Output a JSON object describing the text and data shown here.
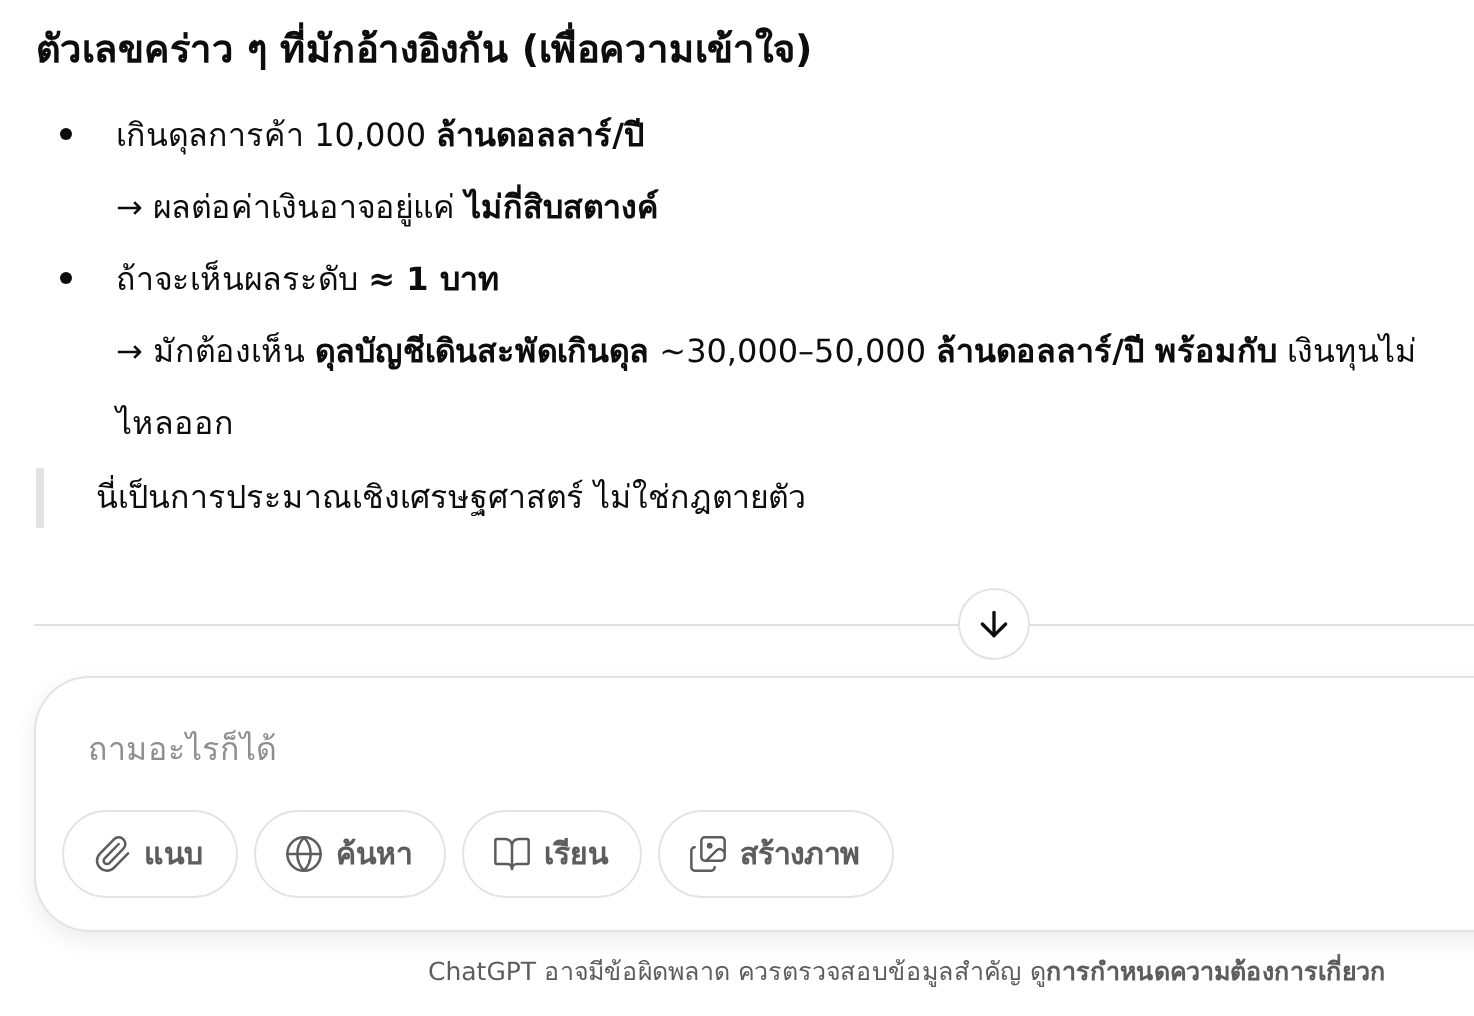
{
  "heading": "ตัวเลขคร่าว ๆ ที่มักอ้างอิงกัน (เพื่อความเข้าใจ)",
  "bullets": [
    {
      "lines": [
        "เกินดุลการค้า 10,000 **ล้านดอลลาร์/ปี**",
        "→ ผลต่อค่าเงินอาจอยู่แค่ **ไม่กี่สิบสตางค์**"
      ]
    },
    {
      "lines": [
        "ถ้าจะเห็นผลระดับ **≈ 1 บาท**",
        "→ มักต้องเห็น **ดุลบัญชีเดินสะพัดเกินดุล** ~30,000–50,000 **ล้านดอลลาร์/ปี พร้อมกับ** เงินทุนไม่ไหลออก"
      ]
    }
  ],
  "quote": "นี่เป็นการประมาณเชิงเศรษฐศาสตร์ ไม่ใช่กฎตายตัว",
  "composer": {
    "placeholder": "ถามอะไรก็ได้",
    "tools": [
      {
        "kind": "attach",
        "label": "แนบ"
      },
      {
        "kind": "search",
        "label": "ค้นหา"
      },
      {
        "kind": "study",
        "label": "เรียน"
      },
      {
        "kind": "image",
        "label": "สร้างภาพ"
      }
    ]
  },
  "footer": "ChatGPT อาจมีข้อผิดพลาด ควรตรวจสอบข้อมูลสำคัญ ดู**การกำหนดความต้องการเกี่ยวก**"
}
